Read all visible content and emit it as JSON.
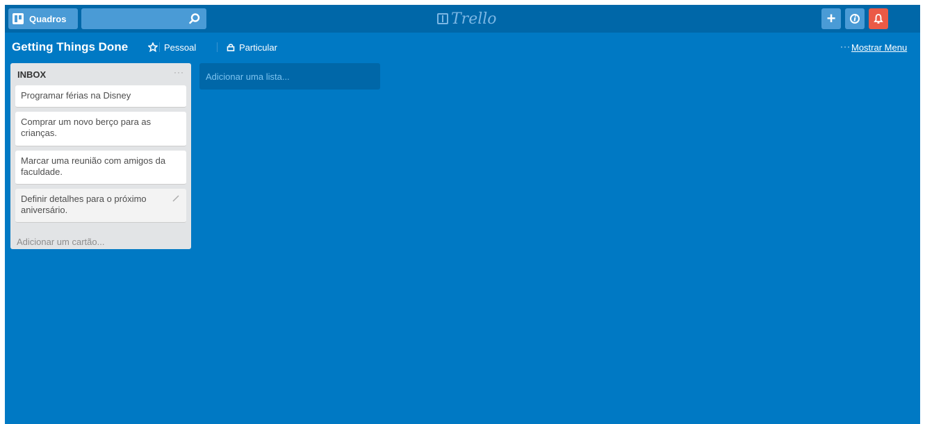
{
  "header": {
    "boards_label": "Quadros",
    "search": {
      "value": "",
      "placeholder": ""
    },
    "logo_text": "Trello",
    "icons": [
      "boards-icon",
      "search-icon",
      "add-icon",
      "info-icon",
      "bell-icon"
    ],
    "accent_color": "#0079c4",
    "bell_color": "#eb5a46"
  },
  "board": {
    "title": "Getting Things Done",
    "team": "Pessoal",
    "visibility": "Particular",
    "menu_link": "Mostrar Menu"
  },
  "lists": [
    {
      "title": "INBOX",
      "cards": [
        "Programar férias na Disney",
        "Comprar um novo berço para as crianças.",
        "Marcar uma reunião com amigos da faculdade.",
        "Definir detalhes para o próximo aniversário."
      ],
      "add_card": "Adicionar um cartão..."
    }
  ],
  "add_list": "Adicionar uma lista..."
}
